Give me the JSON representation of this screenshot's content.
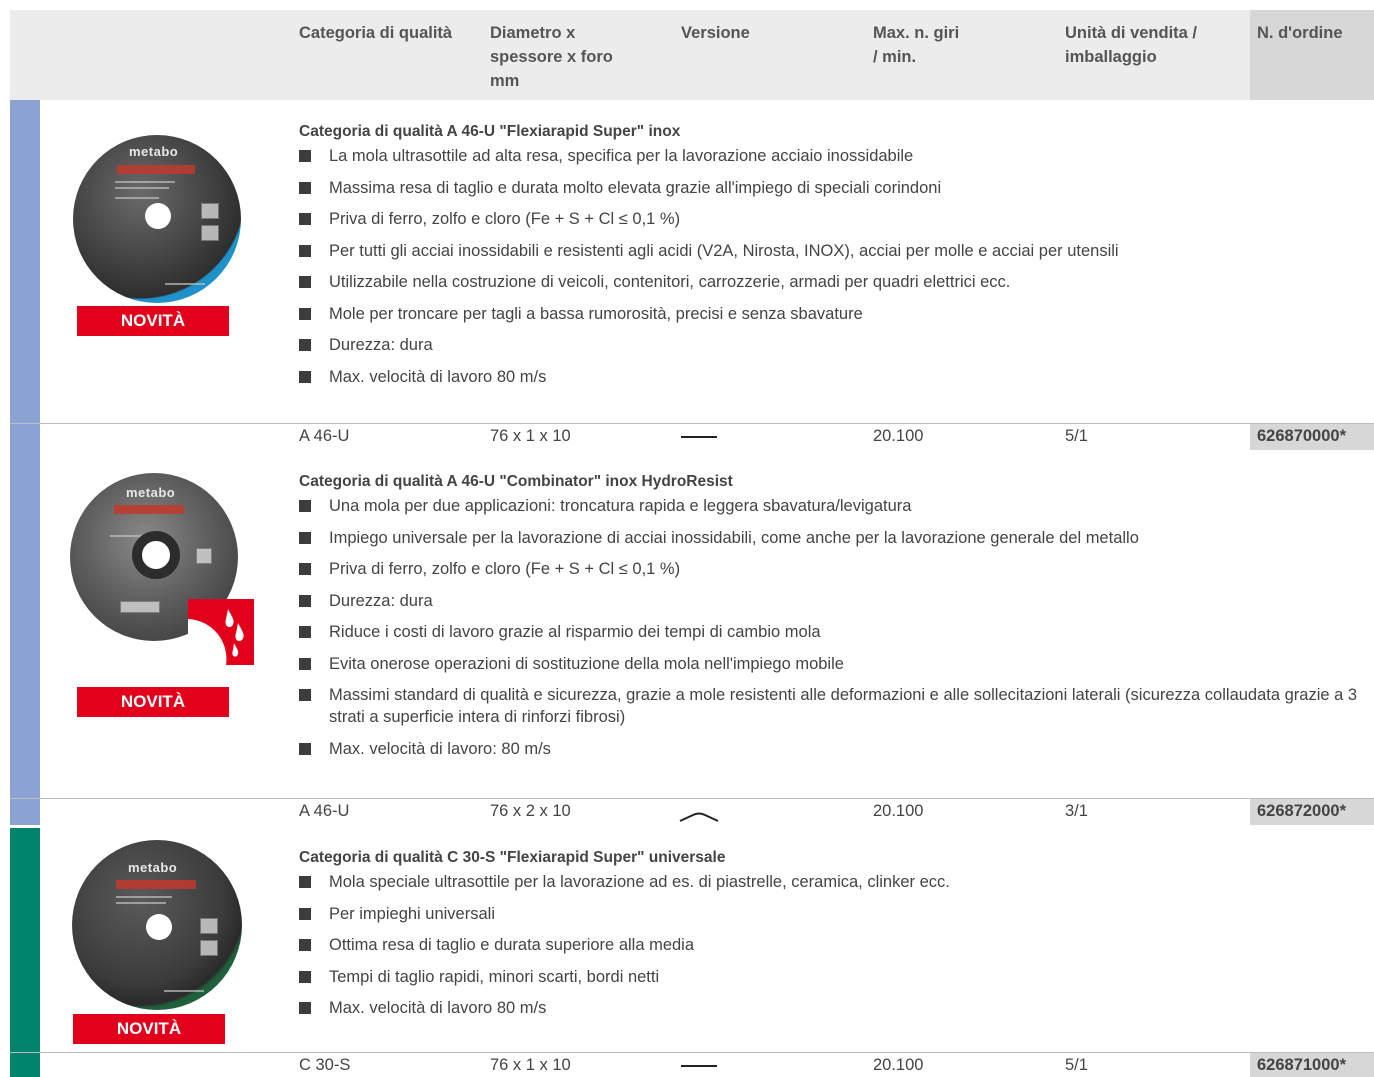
{
  "header": {
    "columns": [
      "Categoria di qualità",
      "Diametro x\nspessore x foro\nmm",
      "Versione",
      "Max. n. giri\n/ min.",
      "Unità di vendita /\nimballaggio",
      "N. d'ordine"
    ]
  },
  "colors": {
    "stripe_blue": "#8aa3d3",
    "stripe_green": "#00836b",
    "novita_red": "#e2001a",
    "order_cell": "#d7d7d7"
  },
  "products": [
    {
      "badge": "NOVITÀ",
      "title": "Categoria di qualità A 46-U \"Flexiarapid Super\" inox",
      "bullets": [
        "La mola ultrasottile ad alta resa, specifica per la lavorazione acciaio inossidabile",
        " Massima resa di taglio e durata molto elevata grazie all'impiego di speciali corindoni",
        "Priva di ferro, zolfo e cloro (Fe + S + Cl ≤ 0,1 %)",
        "Per tutti gli acciai inossidabili e resistenti agli acidi (V2A, Nirosta, INOX), acciai per molle e acciai per utensili",
        "Utilizzabile nella costruzione di veicoli, contenitori, carrozzerie, armadi per quadri elettrici ecc.",
        "Mole per troncare per tagli a bassa rumorosità, precisi e senza sbavature",
        "Durezza: dura",
        "Max. velocità di lavoro 80 m/s"
      ],
      "row": {
        "quality": "A 46-U",
        "dimensions": "76 x 1 x 10",
        "version_icon": "flat-disc-line-icon",
        "max_rpm": "20.100",
        "unit": "5/1",
        "order_no": "626870000*"
      },
      "disc_brand": "metabo"
    },
    {
      "badge": "NOVITÀ",
      "title": "Categoria di qualità A 46-U \"Combinator\" inox HydroResist",
      "bullets": [
        "Una mola per due applicazioni: troncatura rapida e leggera sbavatura/levigatura",
        "Impiego universale per la lavorazione di acciai inossidabili, come anche per la lavorazione generale del metallo",
        "Priva di ferro, zolfo e cloro (Fe + S + Cl ≤ 0,1 %)",
        "Durezza: dura",
        "Riduce i costi di lavoro grazie al risparmio dei tempi di cambio mola",
        "Evita onerose operazioni di sostituzione della mola nell'impiego mobile",
        "Massimi standard di qualità e sicurezza, grazie a mole resistenti alle deformazioni e alle sollecitazioni laterali (sicurezza collaudata grazie a 3 strati a superficie intera di rinforzi fibrosi)",
        "Max. velocità di lavoro: 80 m/s"
      ],
      "row": {
        "quality": "A 46-U",
        "dimensions": "76 x 2 x 10",
        "version_icon": "depressed-center-arc-icon",
        "max_rpm": "20.100",
        "unit": "3/1",
        "order_no": "626872000*"
      },
      "disc_brand": "metabo"
    },
    {
      "badge": "NOVITÀ",
      "title": "Categoria di qualità C 30-S \"Flexiarapid Super\" universale",
      "bullets": [
        "Mola speciale ultrasottile per la lavorazione ad es. di piastrelle, ceramica, clinker ecc.",
        "Per impieghi universali",
        "Ottima resa di taglio e durata superiore alla media",
        "Tempi di taglio rapidi, minori scarti, bordi netti",
        "Max. velocità di lavoro 80 m/s"
      ],
      "row": {
        "quality": "C 30-S",
        "dimensions": "76 x 1 x 10",
        "version_icon": "flat-disc-line-icon",
        "max_rpm": "20.100",
        "unit": "5/1",
        "order_no": "626871000*"
      },
      "disc_brand": "metabo"
    }
  ]
}
